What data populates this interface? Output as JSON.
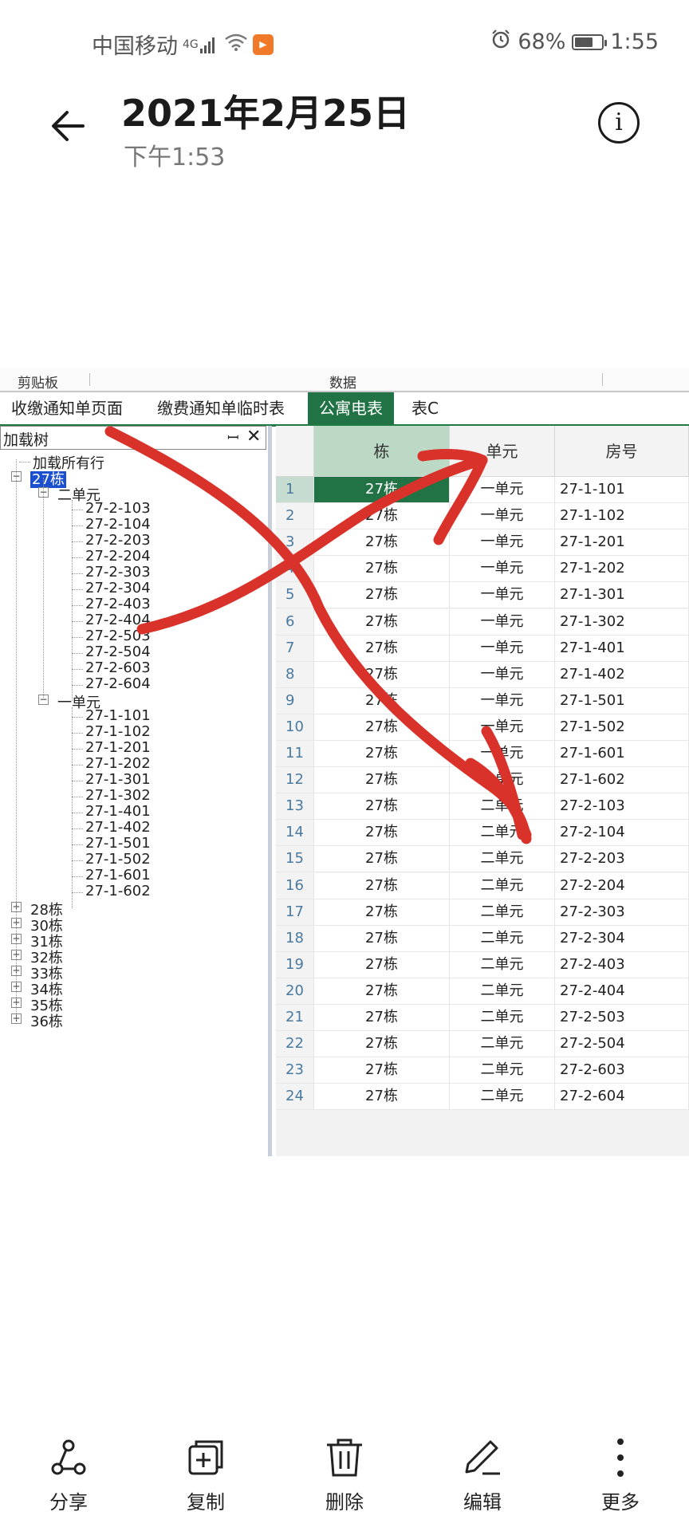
{
  "status": {
    "carrier": "中国移动",
    "network": "4G",
    "battery": "68%",
    "battery_level": 0.68,
    "time": "1:55"
  },
  "header": {
    "title": "2021年2月25日",
    "subtitle": "下午1:53"
  },
  "screenshot": {
    "ribbon": {
      "group1": "剪贴板",
      "group2": "数据"
    },
    "tabs": [
      "收缴通知单页面",
      "缴费通知单临时表",
      "公寓电表",
      "表C"
    ],
    "active_tab": 2,
    "tree": {
      "title": "加载树",
      "load_all": "加载所有行",
      "building": "27栋",
      "unit2": "二单元",
      "unit2_rooms": [
        "27-2-103",
        "27-2-104",
        "27-2-203",
        "27-2-204",
        "27-2-303",
        "27-2-304",
        "27-2-403",
        "27-2-404",
        "27-2-503",
        "27-2-504",
        "27-2-603",
        "27-2-604"
      ],
      "unit1": "一单元",
      "unit1_rooms": [
        "27-1-101",
        "27-1-102",
        "27-1-201",
        "27-1-202",
        "27-1-301",
        "27-1-302",
        "27-1-401",
        "27-1-402",
        "27-1-501",
        "27-1-502",
        "27-1-601",
        "27-1-602"
      ],
      "other_buildings": [
        "28栋",
        "30栋",
        "31栋",
        "32栋",
        "33栋",
        "34栋",
        "35栋",
        "36栋"
      ]
    },
    "grid": {
      "headers": [
        "栋",
        "单元",
        "房号"
      ],
      "rows": [
        [
          "1",
          "27栋",
          "一单元",
          "27-1-101"
        ],
        [
          "2",
          "27栋",
          "一单元",
          "27-1-102"
        ],
        [
          "3",
          "27栋",
          "一单元",
          "27-1-201"
        ],
        [
          "4",
          "27栋",
          "一单元",
          "27-1-202"
        ],
        [
          "5",
          "27栋",
          "一单元",
          "27-1-301"
        ],
        [
          "6",
          "27栋",
          "一单元",
          "27-1-302"
        ],
        [
          "7",
          "27栋",
          "一单元",
          "27-1-401"
        ],
        [
          "8",
          "27栋",
          "一单元",
          "27-1-402"
        ],
        [
          "9",
          "27栋",
          "一单元",
          "27-1-501"
        ],
        [
          "10",
          "27栋",
          "一单元",
          "27-1-502"
        ],
        [
          "11",
          "27栋",
          "一单元",
          "27-1-601"
        ],
        [
          "12",
          "27栋",
          "一单元",
          "27-1-602"
        ],
        [
          "13",
          "27栋",
          "二单元",
          "27-2-103"
        ],
        [
          "14",
          "27栋",
          "二单元",
          "27-2-104"
        ],
        [
          "15",
          "27栋",
          "二单元",
          "27-2-203"
        ],
        [
          "16",
          "27栋",
          "二单元",
          "27-2-204"
        ],
        [
          "17",
          "27栋",
          "二单元",
          "27-2-303"
        ],
        [
          "18",
          "27栋",
          "二单元",
          "27-2-304"
        ],
        [
          "19",
          "27栋",
          "二单元",
          "27-2-403"
        ],
        [
          "20",
          "27栋",
          "二单元",
          "27-2-404"
        ],
        [
          "21",
          "27栋",
          "二单元",
          "27-2-503"
        ],
        [
          "22",
          "27栋",
          "二单元",
          "27-2-504"
        ],
        [
          "23",
          "27栋",
          "二单元",
          "27-2-603"
        ],
        [
          "24",
          "27栋",
          "二单元",
          "27-2-604"
        ]
      ]
    },
    "annotation_color": "#d9322a"
  },
  "bottom_bar": [
    "分享",
    "复制",
    "删除",
    "编辑",
    "更多"
  ],
  "icons": [
    "back-arrow-icon",
    "info-icon",
    "share-icon",
    "copy-icon",
    "delete-icon",
    "edit-icon",
    "more-icon"
  ]
}
